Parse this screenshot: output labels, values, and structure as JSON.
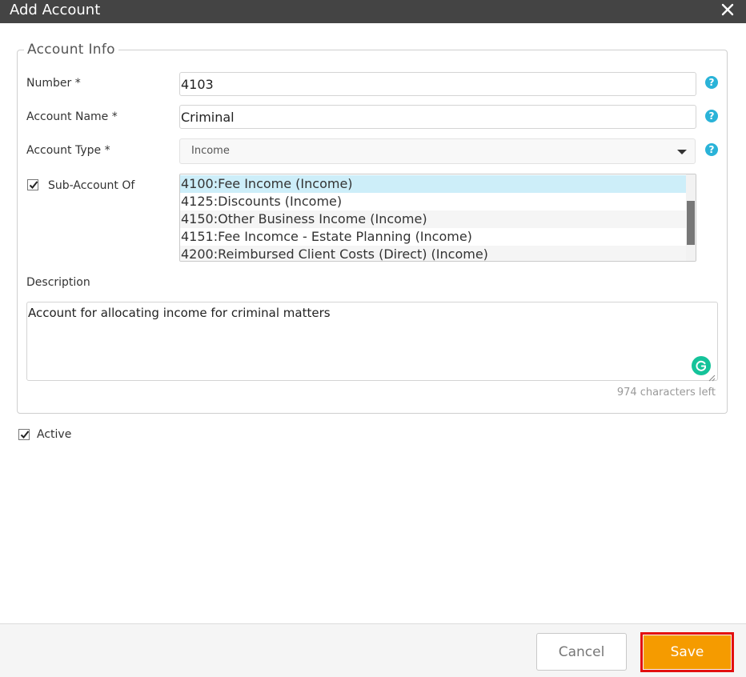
{
  "window": {
    "title": "Add Account"
  },
  "form": {
    "section_title": "Account Info",
    "number": {
      "label": "Number *",
      "value": "4103"
    },
    "account_name": {
      "label": "Account Name *",
      "value": "Criminal"
    },
    "account_type": {
      "label": "Account Type *",
      "value": "Income"
    },
    "sub_account": {
      "label": "Sub-Account Of",
      "checked": true,
      "options": [
        "4100:Fee Income (Income)",
        "4125:Discounts (Income)",
        "4150:Other Business Income (Income)",
        "4151:Fee Incomce - Estate Planning (Income)",
        "4200:Reimbursed Client Costs (Direct) (Income)"
      ],
      "selected_index": 0
    },
    "description": {
      "label": "Description",
      "value": "Account for allocating income for criminal matters",
      "chars_left": "974 characters left"
    },
    "active": {
      "label": "Active",
      "checked": true
    }
  },
  "footer": {
    "cancel_label": "Cancel",
    "save_label": "Save"
  },
  "colors": {
    "titlebar": "#444444",
    "help_icon": "#2ab3d8",
    "selected_option": "#cdeef9",
    "save_button": "#f59b00",
    "save_highlight": "#e31010",
    "grammarly": "#15c39a"
  },
  "icons": {
    "close": "close-icon",
    "help": "help-icon",
    "dropdown": "chevron-down-icon",
    "checkbox": "checkmark-icon",
    "grammarly": "grammarly-icon"
  }
}
